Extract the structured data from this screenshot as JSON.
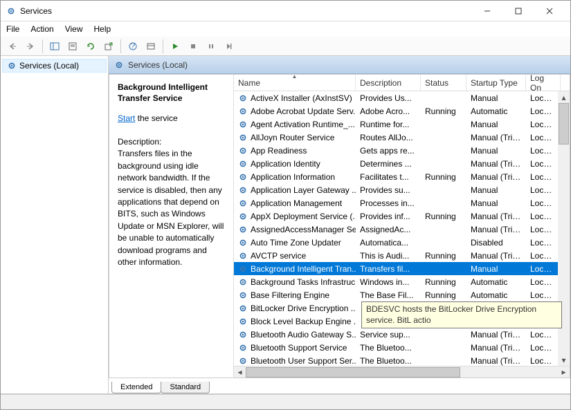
{
  "window": {
    "title": "Services"
  },
  "menus": [
    "File",
    "Action",
    "View",
    "Help"
  ],
  "leftPane": {
    "label": "Services (Local)"
  },
  "headerStrip": {
    "label": "Services (Local)"
  },
  "detail": {
    "title": "Background Intelligent Transfer Service",
    "startLink": "Start",
    "startSuffix": " the service",
    "descLabel": "Description:",
    "descText": "Transfers files in the background using idle network bandwidth. If the service is disabled, then any applications that depend on BITS, such as Windows Update or MSN Explorer, will be unable to automatically download programs and other information."
  },
  "columns": {
    "name": "Name",
    "desc": "Description",
    "status": "Status",
    "startup": "Startup Type",
    "logon": "Log On"
  },
  "rows": [
    {
      "name": "ActiveX Installer (AxInstSV)",
      "desc": "Provides Us...",
      "status": "",
      "startup": "Manual",
      "logon": "Local Sy"
    },
    {
      "name": "Adobe Acrobat Update Serv...",
      "desc": "Adobe Acro...",
      "status": "Running",
      "startup": "Automatic",
      "logon": "Local Sy"
    },
    {
      "name": "Agent Activation Runtime_...",
      "desc": "Runtime for...",
      "status": "",
      "startup": "Manual",
      "logon": "Local Sy"
    },
    {
      "name": "AllJoyn Router Service",
      "desc": "Routes AllJo...",
      "status": "",
      "startup": "Manual (Trig...",
      "logon": "Local Se"
    },
    {
      "name": "App Readiness",
      "desc": "Gets apps re...",
      "status": "",
      "startup": "Manual",
      "logon": "Local Sy"
    },
    {
      "name": "Application Identity",
      "desc": "Determines ...",
      "status": "",
      "startup": "Manual (Trig...",
      "logon": "Local Se"
    },
    {
      "name": "Application Information",
      "desc": "Facilitates t...",
      "status": "Running",
      "startup": "Manual (Trig...",
      "logon": "Local Sy"
    },
    {
      "name": "Application Layer Gateway ...",
      "desc": "Provides su...",
      "status": "",
      "startup": "Manual",
      "logon": "Local Se"
    },
    {
      "name": "Application Management",
      "desc": "Processes in...",
      "status": "",
      "startup": "Manual",
      "logon": "Local Sy"
    },
    {
      "name": "AppX Deployment Service (...",
      "desc": "Provides inf...",
      "status": "Running",
      "startup": "Manual (Trig...",
      "logon": "Local Sy"
    },
    {
      "name": "AssignedAccessManager Se...",
      "desc": "AssignedAc...",
      "status": "",
      "startup": "Manual (Trig...",
      "logon": "Local Sy"
    },
    {
      "name": "Auto Time Zone Updater",
      "desc": "Automatica...",
      "status": "",
      "startup": "Disabled",
      "logon": "Local Se"
    },
    {
      "name": "AVCTP service",
      "desc": "This is Audi...",
      "status": "Running",
      "startup": "Manual (Trig...",
      "logon": "Local Se"
    },
    {
      "name": "Background Intelligent Tran...",
      "desc": "Transfers fil...",
      "status": "",
      "startup": "Manual",
      "logon": "Local Sy",
      "selected": true
    },
    {
      "name": "Background Tasks Infrastruc...",
      "desc": "Windows in...",
      "status": "Running",
      "startup": "Automatic",
      "logon": "Local Sy"
    },
    {
      "name": "Base Filtering Engine",
      "desc": "The Base Fil...",
      "status": "Running",
      "startup": "Automatic",
      "logon": "Local Se"
    },
    {
      "name": "BitLocker Drive Encryption ...",
      "desc": "",
      "status": "",
      "startup": "",
      "logon": ""
    },
    {
      "name": "Block Level Backup Engine ...",
      "desc": "",
      "status": "",
      "startup": "",
      "logon": ""
    },
    {
      "name": "Bluetooth Audio Gateway S...",
      "desc": "Service sup...",
      "status": "",
      "startup": "Manual (Trig...",
      "logon": "Local Se"
    },
    {
      "name": "Bluetooth Support Service",
      "desc": "The Bluetoo...",
      "status": "",
      "startup": "Manual (Trig...",
      "logon": "Local Se"
    },
    {
      "name": "Bluetooth User Support Ser...",
      "desc": "The Bluetoo...",
      "status": "",
      "startup": "Manual (Trig...",
      "logon": "Local Sy"
    }
  ],
  "tooltip": "BDESVC hosts the BitLocker Drive Encryption service. BitL actio",
  "tabs": {
    "extended": "Extended",
    "standard": "Standard"
  }
}
